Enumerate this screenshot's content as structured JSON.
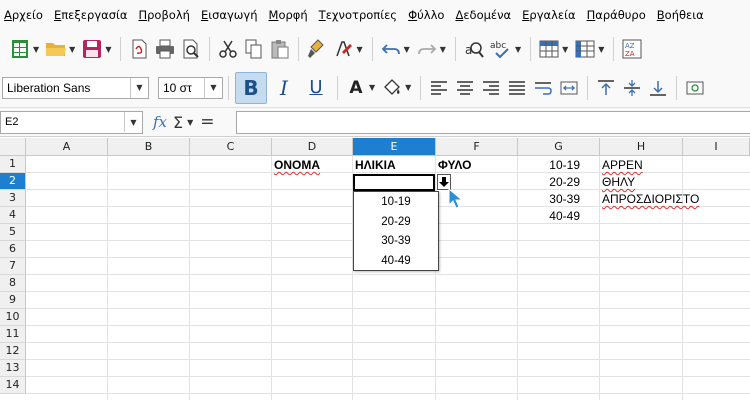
{
  "menu": [
    "Αρχείο",
    "Επεξεργασία",
    "Προβολή",
    "Εισαγωγή",
    "Μορφή",
    "Τεχνοτροπίες",
    "Φύλλο",
    "Δεδομένα",
    "Εργαλεία",
    "Παράθυρο",
    "Βοήθεια"
  ],
  "toolbar": {
    "font_name": "Liberation Sans",
    "font_size": "10 στ",
    "bold_label": "B",
    "italic_label": "I",
    "underline_label": "U",
    "font_color_label": "A",
    "spell_label": "abc"
  },
  "formula_bar": {
    "name_box": "E2",
    "function_wizard_label": "fx",
    "sum_label": "Σ",
    "formula_label": "=",
    "content": ""
  },
  "grid": {
    "columns": [
      "A",
      "B",
      "C",
      "D",
      "E",
      "F",
      "G",
      "H",
      "I"
    ],
    "selected_column": "E",
    "rows": [
      "1",
      "2",
      "3",
      "4",
      "5",
      "6",
      "7",
      "8",
      "9",
      "10",
      "11",
      "12",
      "13",
      "14"
    ],
    "selected_row": "2",
    "cells": {
      "D1": "ΟΝΟΜΑ",
      "E1": "ΗΛΙΚΙΑ",
      "F1": "ΦΥΛΟ",
      "G1": "10-19",
      "G2": "20-29",
      "G3": "30-39",
      "G4": "40-49",
      "H1": "ΑΡΡΕΝ",
      "H2": "ΘΗΛΥ",
      "H3": "ΑΠΡΟΣΔΙΟΡΙΣΤΟ"
    }
  },
  "dropdown": {
    "options": [
      "10-19",
      "20-29",
      "30-39",
      "40-49"
    ]
  },
  "colors": {
    "selection": "#1e7fd1",
    "bold_active": "#c5dcf0",
    "spell_error": "#e03030"
  },
  "icons": [
    "new-document-icon",
    "open-folder-icon",
    "save-icon",
    "export-pdf-icon",
    "print-icon",
    "print-preview-icon",
    "cut-icon",
    "copy-icon",
    "paste-icon",
    "clone-formatting-icon",
    "clear-formatting-icon",
    "undo-icon",
    "redo-icon",
    "find-replace-icon",
    "spellcheck-icon",
    "row-icon",
    "column-icon",
    "sort-icon"
  ]
}
